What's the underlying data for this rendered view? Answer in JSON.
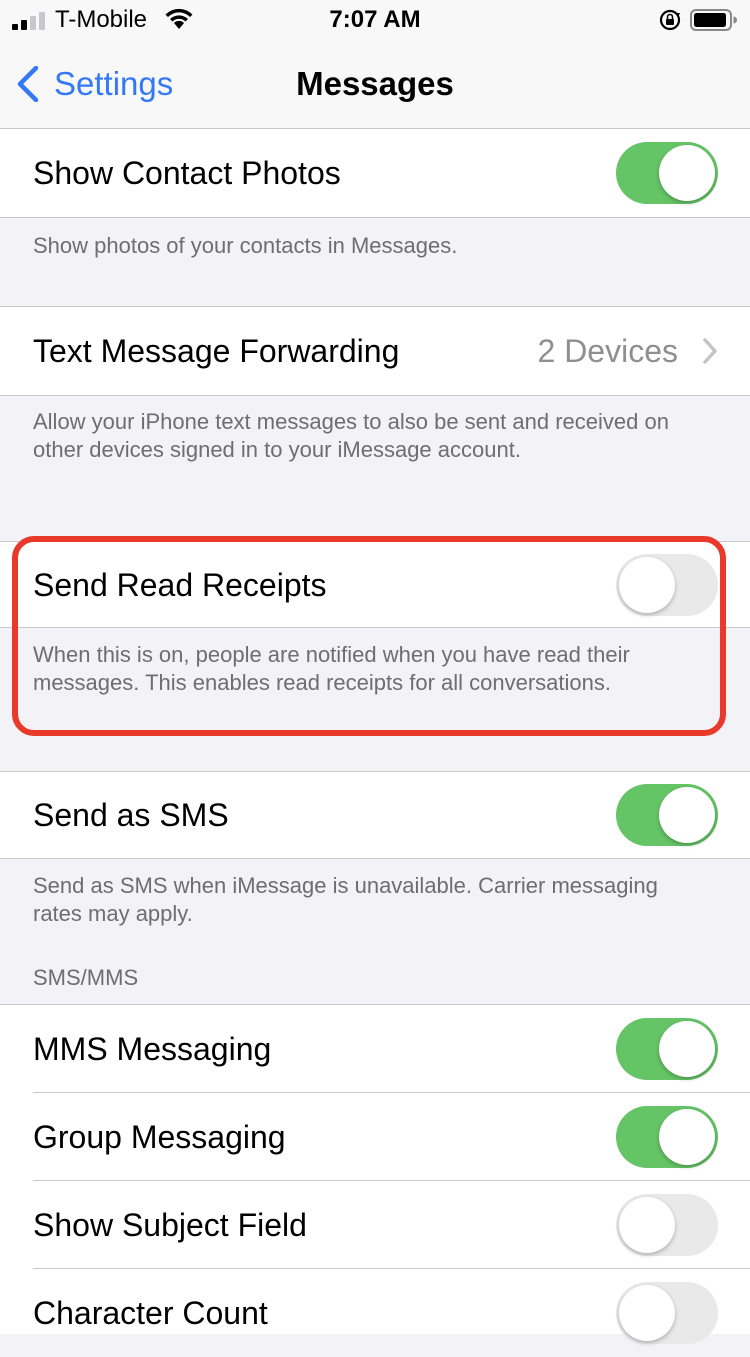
{
  "status_bar": {
    "carrier": "T-Mobile",
    "time": "7:07 AM",
    "icons": [
      "signal-icon",
      "wifi-icon",
      "orientation-lock-icon",
      "battery-icon"
    ]
  },
  "nav": {
    "back_label": "Settings",
    "title": "Messages"
  },
  "rows": {
    "show_contact_photos": {
      "label": "Show Contact Photos",
      "on": true
    },
    "text_forwarding": {
      "label": "Text Message Forwarding",
      "value": "2 Devices"
    },
    "read_receipts": {
      "label": "Send Read Receipts",
      "on": false
    },
    "send_as_sms": {
      "label": "Send as SMS",
      "on": true
    },
    "mms": {
      "label": "MMS Messaging",
      "on": true
    },
    "group": {
      "label": "Group Messaging",
      "on": true
    },
    "subject": {
      "label": "Show Subject Field",
      "on": false
    },
    "char_count": {
      "label": "Character Count",
      "on": false
    }
  },
  "footers": {
    "contact_photos": "Show photos of your contacts in Messages.",
    "forwarding": "Allow your iPhone text messages to also be sent and received on other devices signed in to your iMessage account.",
    "read_receipts": "When this is on, people are notified when you have read their messages. This enables read receipts for all conversations.",
    "sms": "Send as SMS when iMessage is unavailable. Carrier messaging rates may apply."
  },
  "section_headers": {
    "sms_mms": "SMS/MMS"
  },
  "colors": {
    "accent": "#3478f6",
    "toggle_on": "#65c466",
    "highlight": "#e8392a"
  }
}
